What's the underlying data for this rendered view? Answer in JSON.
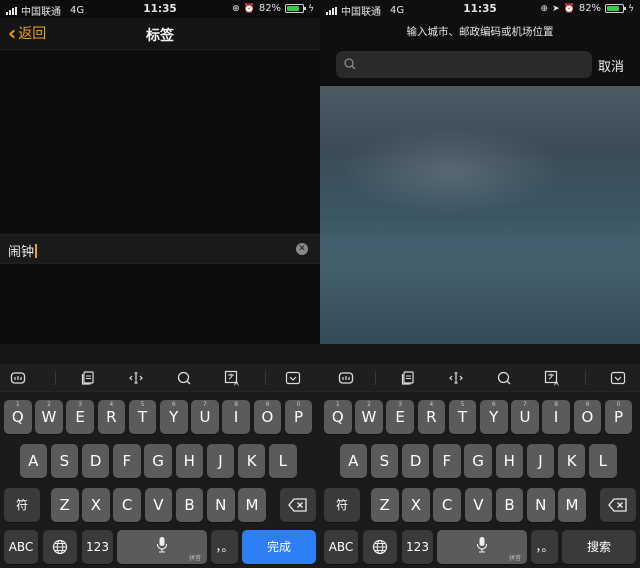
{
  "status_left": {
    "carrier": "中国联通",
    "network": "4G",
    "time": "11:35",
    "battery": "82%",
    "battery_level": 0.82
  },
  "status_right": {
    "carrier": "中国联通",
    "network": "4G",
    "time": "11:35",
    "battery": "82%",
    "battery_level": 0.82
  },
  "left": {
    "back_label": "返回",
    "title": "标签",
    "label_value": "闹钟"
  },
  "right": {
    "hint": "输入城市、邮政编码或机场位置",
    "search_value": "",
    "cancel_label": "取消"
  },
  "keyboard": {
    "row1": [
      "Q",
      "W",
      "E",
      "R",
      "T",
      "Y",
      "U",
      "I",
      "O",
      "P"
    ],
    "row1_hints": [
      "1",
      "2",
      "3",
      "4",
      "5",
      "6",
      "7",
      "8",
      "9",
      "0"
    ],
    "row2": [
      "A",
      "S",
      "D",
      "F",
      "G",
      "H",
      "J",
      "K",
      "L"
    ],
    "row3": [
      "Z",
      "X",
      "C",
      "V",
      "B",
      "N",
      "M"
    ],
    "fu": "符",
    "abc": "ABC",
    "num": "123",
    "punct": "，。",
    "pinyin_hint": "拼音",
    "left_return": "完成",
    "right_return": "搜索"
  },
  "colors": {
    "accent": "#f0a020",
    "done": "#2e7ff6",
    "battery": "#3ec84a"
  },
  "icons": {
    "toolbar": [
      "app-logo-icon",
      "clipboard-icon",
      "cursor-move-icon",
      "search-icon",
      "translate-icon",
      "keyboard-hide-icon"
    ]
  }
}
